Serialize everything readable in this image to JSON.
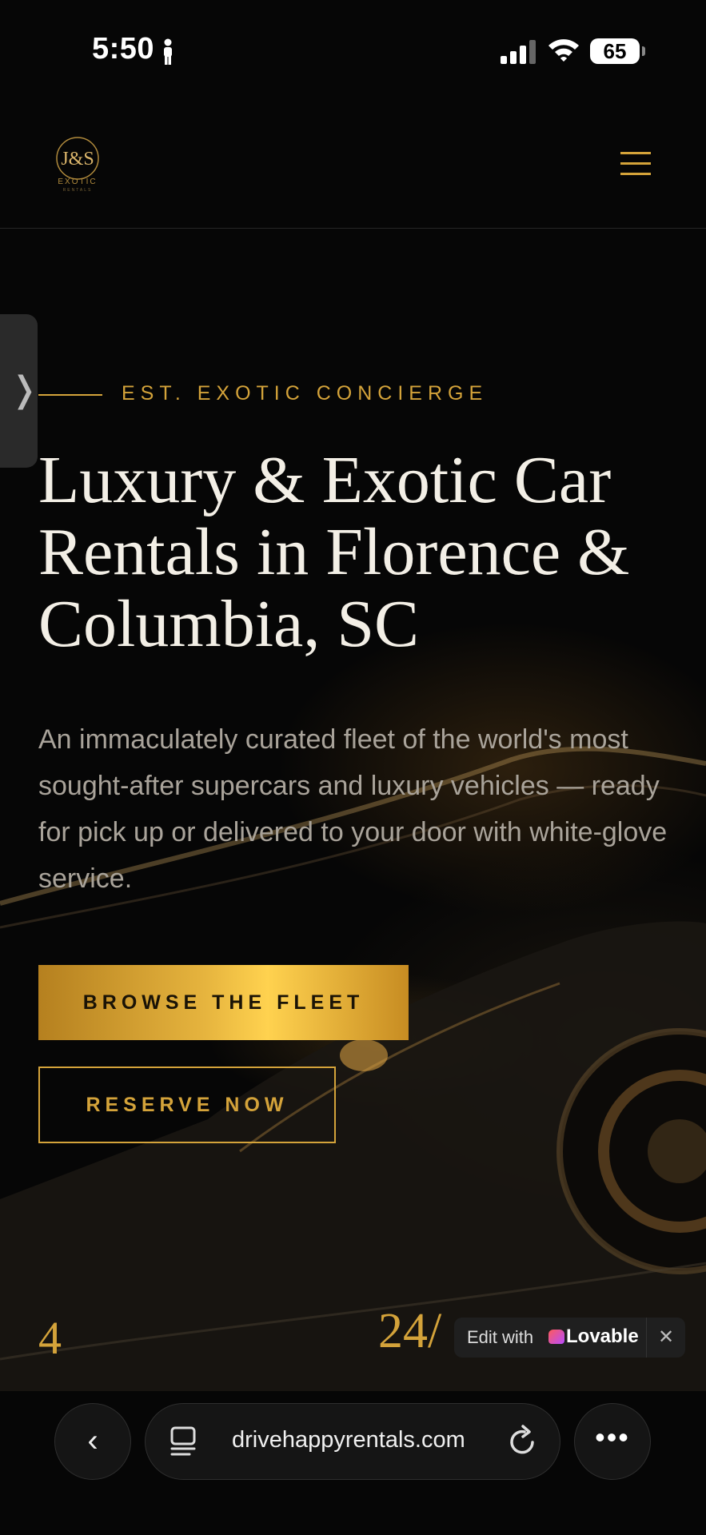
{
  "status_bar": {
    "time": "5:50",
    "battery": "65",
    "icons": [
      "person-icon",
      "cellular-signal-icon",
      "wifi-icon",
      "battery-icon"
    ]
  },
  "header": {
    "logo_text": "J&S",
    "logo_subtext": "EXOTIC",
    "logo_tagline": "RENTALS",
    "menu_icon": "hamburger-menu-icon"
  },
  "side_tab": {
    "icon": "chevron-right-icon",
    "glyph": "❭"
  },
  "hero": {
    "eyebrow": "EST. EXOTIC CONCIERGE",
    "headline": "Luxury & Exotic Car Rentals in Florence & Columbia, SC",
    "lede": "An immaculately curated fleet of the world's most sought-after supercars and luxury vehicles — ready for pick up or delivered to your door with white-glove service.",
    "primary_cta": "BROWSE THE FLEET",
    "secondary_cta": "RESERVE NOW"
  },
  "stats": {
    "first_value": "4",
    "second_value": "24/"
  },
  "lovable_badge": {
    "label": "Edit with",
    "brand": "Lovable",
    "close": "✕"
  },
  "browser": {
    "url": "drivehappyrentals.com",
    "back_glyph": "‹",
    "more_glyph": "•••",
    "icons": [
      "back-arrow-icon",
      "tabs-icon",
      "reload-icon",
      "more-icon"
    ]
  },
  "colors": {
    "accent_gold": "#d4a33a",
    "background": "#060606",
    "headline": "#f3efe6",
    "body_text": "#a9a39a"
  }
}
